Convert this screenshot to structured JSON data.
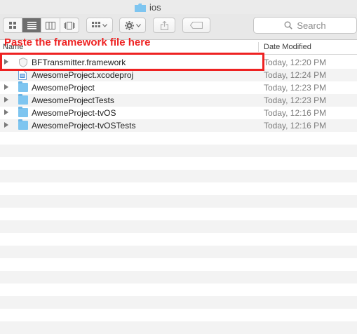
{
  "window": {
    "title": "ios"
  },
  "toolbar": {
    "view_modes": [
      "icon-view",
      "list-view",
      "column-view",
      "cover-flow-view"
    ],
    "arrange_label": "arrange",
    "action_label": "action",
    "search_placeholder": "Search"
  },
  "columns": {
    "name": "Name",
    "date_modified": "Date Modified"
  },
  "annotation": {
    "text": "Paste the framework file here",
    "color": "#ee2222"
  },
  "files": [
    {
      "name": "BFTransmitter.framework",
      "date": "Today, 12:20 PM",
      "kind": "framework",
      "has_disclosure": true
    },
    {
      "name": "AwesomeProject.xcodeproj",
      "date": "Today, 12:24 PM",
      "kind": "xcodeproj",
      "has_disclosure": false
    },
    {
      "name": "AwesomeProject",
      "date": "Today, 12:23 PM",
      "kind": "folder",
      "has_disclosure": true
    },
    {
      "name": "AwesomeProjectTests",
      "date": "Today, 12:23 PM",
      "kind": "folder",
      "has_disclosure": true
    },
    {
      "name": "AwesomeProject-tvOS",
      "date": "Today, 12:16 PM",
      "kind": "folder",
      "has_disclosure": true
    },
    {
      "name": "AwesomeProject-tvOSTests",
      "date": "Today, 12:16 PM",
      "kind": "folder",
      "has_disclosure": true
    }
  ],
  "colors": {
    "folder": "#7ec5f0",
    "accent_red": "#ee2222"
  }
}
